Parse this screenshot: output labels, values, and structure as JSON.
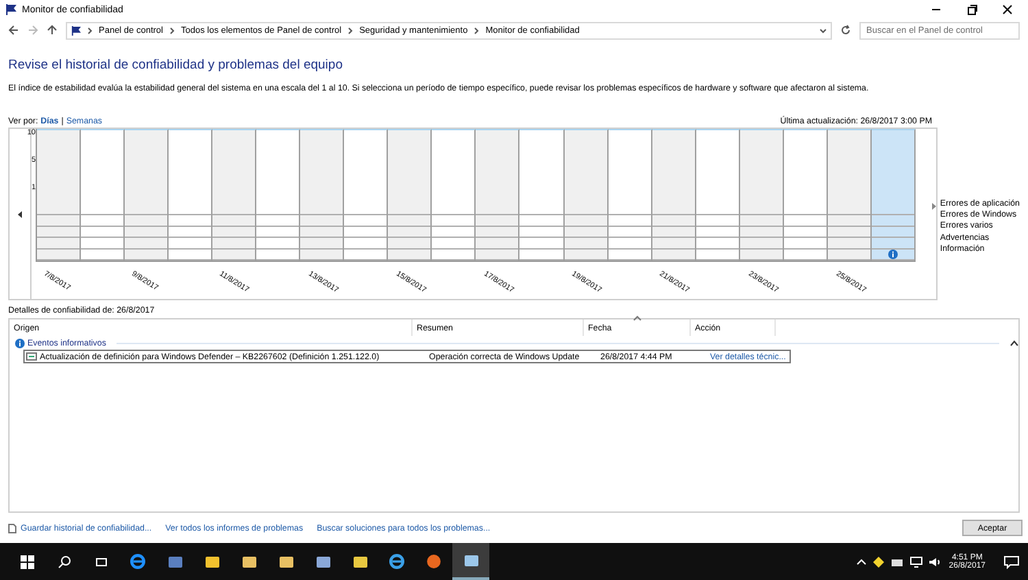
{
  "window": {
    "title": "Monitor de confiabilidad"
  },
  "breadcrumb": [
    "Panel de control",
    "Todos los elementos de Panel de control",
    "Seguridad y mantenimiento",
    "Monitor de confiabilidad"
  ],
  "search": {
    "placeholder": "Buscar en el Panel de control"
  },
  "heading": "Revise el historial de confiabilidad y problemas del equipo",
  "description": "El índice de estabilidad evalúa la estabilidad general del sistema en una escala del 1 al 10. Si selecciona un período de tiempo específico, puede revisar los problemas específicos de hardware y software que afectaron al sistema.",
  "view_by": {
    "label": "Ver por:",
    "separator": "|",
    "options": [
      {
        "label": "Días",
        "selected": true
      },
      {
        "label": "Semanas",
        "selected": false
      }
    ]
  },
  "last_update": "Última actualización: 26/8/2017 3:00 PM",
  "chart": {
    "scale": [
      "10",
      "5",
      "1"
    ],
    "days": [
      {
        "selected": false,
        "info": false
      },
      {
        "selected": false,
        "info": false
      },
      {
        "selected": false,
        "info": false
      },
      {
        "selected": false,
        "info": false
      },
      {
        "selected": false,
        "info": false
      },
      {
        "selected": false,
        "info": false
      },
      {
        "selected": false,
        "info": false
      },
      {
        "selected": false,
        "info": false
      },
      {
        "selected": false,
        "info": false
      },
      {
        "selected": false,
        "info": false
      },
      {
        "selected": false,
        "info": false
      },
      {
        "selected": false,
        "info": false
      },
      {
        "selected": false,
        "info": false
      },
      {
        "selected": false,
        "info": false
      },
      {
        "selected": false,
        "info": false
      },
      {
        "selected": false,
        "info": false
      },
      {
        "selected": false,
        "info": false
      },
      {
        "selected": false,
        "info": false
      },
      {
        "selected": false,
        "info": false
      },
      {
        "selected": true,
        "info": true
      }
    ],
    "date_labels": [
      "7/8/2017",
      "9/8/2017",
      "11/8/2017",
      "13/8/2017",
      "15/8/2017",
      "17/8/2017",
      "19/8/2017",
      "21/8/2017",
      "23/8/2017",
      "25/8/2017"
    ],
    "legend": [
      "Errores de aplicación",
      "Errores de Windows",
      "Errores varios",
      "Advertencias",
      "Información"
    ]
  },
  "details_title": "Detalles de confiabilidad de: 26/8/2017",
  "table": {
    "columns": [
      "Origen",
      "Resumen",
      "Fecha",
      "Acción"
    ],
    "groups": [
      {
        "label": "Eventos informativos",
        "expanded": true,
        "rows": [
          {
            "source": "Actualización de definición para Windows Defender – KB2267602 (Definición 1.251.122.0)",
            "summary": "Operación correcta de Windows Update",
            "date": "26/8/2017 4:44 PM",
            "action": "Ver detalles técnic..."
          }
        ]
      }
    ]
  },
  "footer": {
    "links": [
      "Guardar historial de confiabilidad...",
      "Ver todos los informes de problemas",
      "Buscar soluciones para todos los problemas..."
    ],
    "button": "Aceptar"
  },
  "taskbar": {
    "time": "4:51 PM",
    "date": "26/8/2017"
  }
}
